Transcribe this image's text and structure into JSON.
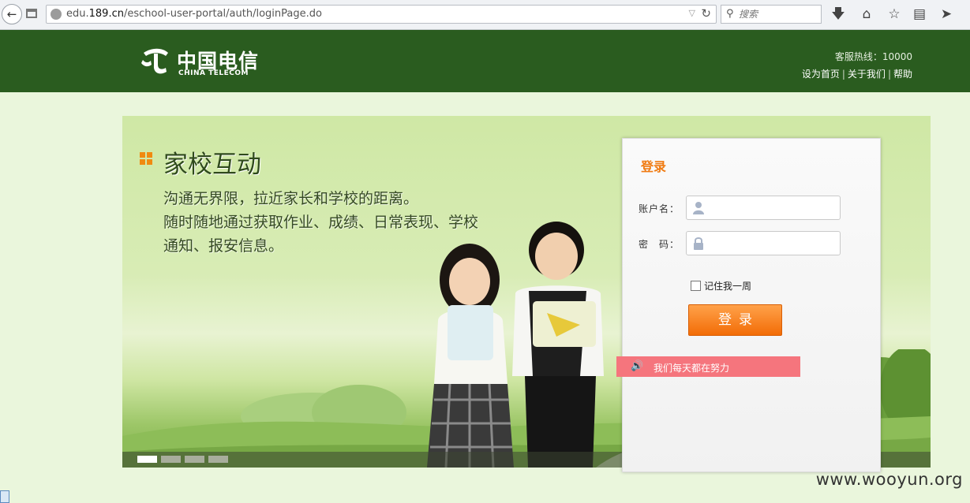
{
  "browser": {
    "url_prefix": "edu.",
    "url_domain": "189.cn",
    "url_path": "/eschool-user-portal/auth/loginPage.do",
    "search_placeholder": "搜索"
  },
  "header": {
    "logo_cn": "中国电信",
    "logo_en": "CHINA TELECOM",
    "hotline": "客服热线：10000",
    "links": [
      "设为首页",
      "关于我们",
      "帮助"
    ]
  },
  "banner": {
    "title": "家校互动",
    "lines": [
      "沟通无界限，拉近家长和学校的距离。",
      "随时随地通过获取作业、成绩、日常表现、学校",
      "通知、报安信息。"
    ]
  },
  "login": {
    "title": "登录",
    "username_label": "账户名：",
    "password_label": "密　码：",
    "remember_label": "记住我一周",
    "submit_label": "登录"
  },
  "notice": {
    "text": "我们每天都在努力"
  },
  "watermark": "www.wooyun.org",
  "colors": {
    "header_bg": "#2a5c1f",
    "accent_orange": "#f07b12",
    "notice_bg": "#f5757d"
  }
}
